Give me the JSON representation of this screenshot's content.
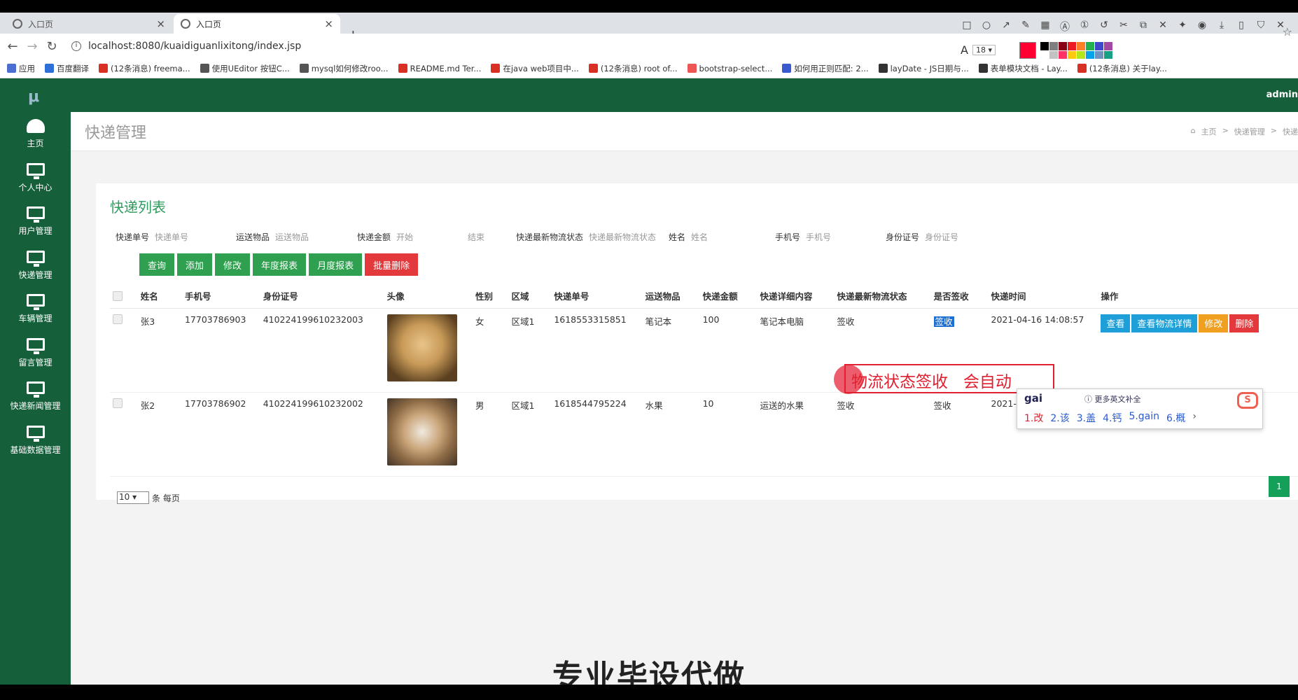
{
  "browser": {
    "tabs": [
      {
        "title": "入口页",
        "close": "×"
      },
      {
        "title": "入口页",
        "close": "×"
      }
    ],
    "new_tab": "+",
    "url": "localhost:8080/kuaidiguanlixitong/index.jsp",
    "nav": {
      "back": "←",
      "forward": "→",
      "reload": "↻"
    },
    "annotation": {
      "font_letter": "A",
      "font_size": "18"
    },
    "bookmarks": [
      "应用",
      "百度翻译",
      "(12条消息) freema...",
      "使用UEditor 按钮C...",
      "mysql如何修改roo...",
      "README.md    Ter...",
      "在java web项目中...",
      "(12条消息) root of...",
      "bootstrap-select...",
      "如何用正则匹配: 2...",
      "layDate - JS日期与...",
      "表单模块文档 - Lay...",
      "(12条消息) 关于lay..."
    ],
    "swatch_colors": [
      "#000000",
      "#7f7f7f",
      "#880015",
      "#ed1c24",
      "#ff7f27",
      "#22b14c",
      "#3f48cc",
      "#a349a4",
      "#ffffff",
      "#c3c3c3",
      "#ff3366",
      "#ffc90e",
      "#b5e61d",
      "#00a2e8",
      "#7092be",
      "#16a085"
    ]
  },
  "app": {
    "brand_color": "#15603a",
    "logo": "μ",
    "user": "admin",
    "sidebar": [
      {
        "label": "主页",
        "icon": "dashboard-icon"
      },
      {
        "label": "个人中心",
        "icon": "monitor-icon"
      },
      {
        "label": "用户管理",
        "icon": "monitor-icon"
      },
      {
        "label": "快递管理",
        "icon": "monitor-icon"
      },
      {
        "label": "车辆管理",
        "icon": "monitor-icon"
      },
      {
        "label": "留言管理",
        "icon": "monitor-icon"
      },
      {
        "label": "快递新闻管理",
        "icon": "monitor-icon"
      },
      {
        "label": "基础数据管理",
        "icon": "monitor-icon"
      }
    ],
    "page_title": "快递管理",
    "breadcrumb": [
      "主页",
      ">",
      "快递管理",
      ">",
      "快递"
    ],
    "card_title": "快递列表",
    "filters": [
      {
        "label": "快递单号",
        "placeholder": "快递单号"
      },
      {
        "label": "运送物品",
        "placeholder": "运送物品"
      },
      {
        "label": "快递金额",
        "placeholder": "开始"
      },
      {
        "label": "",
        "placeholder": "结束"
      },
      {
        "label": "快递最新物流状态",
        "placeholder": "快递最新物流状态"
      },
      {
        "label": "姓名",
        "placeholder": "姓名"
      },
      {
        "label": "手机号",
        "placeholder": "手机号"
      },
      {
        "label": "身份证号",
        "placeholder": "身份证号"
      }
    ],
    "buttons": {
      "query": "查询",
      "add": "添加",
      "edit": "修改",
      "yearly": "年度报表",
      "monthly": "月度报表",
      "batch_delete": "批量删除"
    },
    "columns": [
      "姓名",
      "手机号",
      "身份证号",
      "头像",
      "性别",
      "区域",
      "快递单号",
      "运送物品",
      "快递金额",
      "快递详细内容",
      "快递最新物流状态",
      "是否签收",
      "快递时间",
      "操作"
    ],
    "rows": [
      {
        "name": "张3",
        "phone": "17703786903",
        "idcard": "410224199610232003",
        "gender": "女",
        "area": "区域1",
        "tracking": "1618553315851",
        "item": "笔记本",
        "amount": "100",
        "detail": "笔记本电脑",
        "status": "签收",
        "signed": "签收",
        "time": "2021-04-16 14:08:57"
      },
      {
        "name": "张2",
        "phone": "17703786902",
        "idcard": "410224199610232002",
        "gender": "男",
        "area": "区域1",
        "tracking": "1618544795224",
        "item": "水果",
        "amount": "10",
        "detail": "运送的水果",
        "status": "签收",
        "signed": "签收",
        "time": "2021-03"
      }
    ],
    "row_actions": {
      "view": "查看",
      "logistics": "查看物流详情",
      "edit": "修改",
      "delete": "删除"
    },
    "pager": {
      "page_size": "10",
      "per_page_label": "条 每页",
      "current_page": "1"
    }
  },
  "overlay": {
    "subtitle": "物流状态签收   会自动",
    "ime": {
      "input": "gai",
      "more": "更多英文补全",
      "candidates": [
        "1.改",
        "2.该",
        "3.盖",
        "4.钙",
        "5.gain",
        "6.概"
      ],
      "next": "›"
    },
    "caption": "专业毕设代做"
  }
}
